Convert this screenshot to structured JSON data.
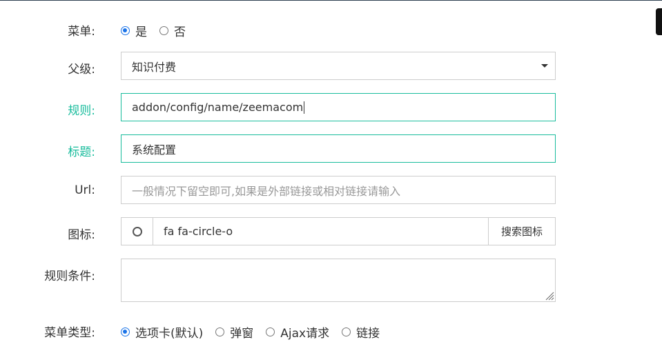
{
  "form": {
    "menu": {
      "label": "菜单:",
      "options": [
        {
          "label": "是",
          "checked": true
        },
        {
          "label": "否",
          "checked": false
        }
      ]
    },
    "parent": {
      "label": "父级:",
      "selected": "知识付费"
    },
    "rule": {
      "label": "规则:",
      "value": "addon/config/name/zeemacom"
    },
    "title": {
      "label": "标题:",
      "value": "系统配置"
    },
    "url": {
      "label": "Url:",
      "placeholder": "一般情况下留空即可,如果是外部链接或相对链接请输入"
    },
    "icon": {
      "label": "图标:",
      "icon_name": "circle-o-icon",
      "value": "fa fa-circle-o",
      "search_button": "搜索图标"
    },
    "condition": {
      "label": "规则条件:",
      "value": ""
    },
    "menu_type": {
      "label": "菜单类型:",
      "options": [
        {
          "label": "选项卡(默认)",
          "checked": true
        },
        {
          "label": "弹窗",
          "checked": false
        },
        {
          "label": "Ajax请求",
          "checked": false
        },
        {
          "label": "链接",
          "checked": false
        }
      ]
    }
  },
  "colors": {
    "valid_border": "#18bc9c",
    "radio_accent": "#1a73e8"
  }
}
